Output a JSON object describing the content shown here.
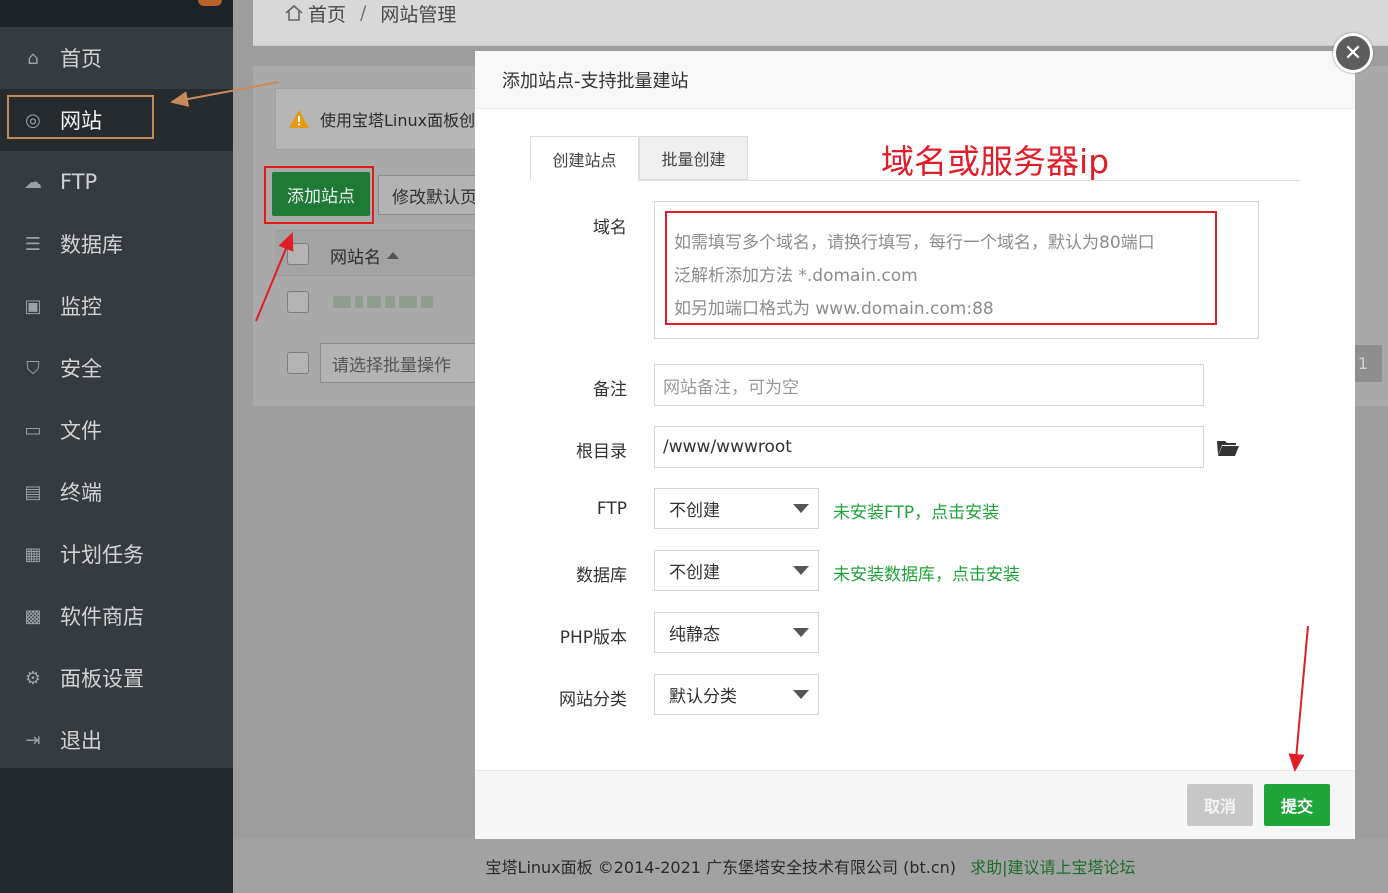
{
  "sidebar": {
    "items": [
      {
        "label": "首页",
        "icon": "home-icon",
        "glyph": "⌂"
      },
      {
        "label": "网站",
        "icon": "globe-icon",
        "glyph": "◎"
      },
      {
        "label": "FTP",
        "icon": "ftp-icon",
        "glyph": "☁"
      },
      {
        "label": "数据库",
        "icon": "database-icon",
        "glyph": "☰"
      },
      {
        "label": "监控",
        "icon": "monitor-icon",
        "glyph": "▣"
      },
      {
        "label": "安全",
        "icon": "shield-icon",
        "glyph": "⛉"
      },
      {
        "label": "文件",
        "icon": "folder-icon",
        "glyph": "▭"
      },
      {
        "label": "终端",
        "icon": "terminal-icon",
        "glyph": "▤"
      },
      {
        "label": "计划任务",
        "icon": "calendar-icon",
        "glyph": "▦"
      },
      {
        "label": "软件商店",
        "icon": "apps-icon",
        "glyph": "▩"
      },
      {
        "label": "面板设置",
        "icon": "gear-icon",
        "glyph": "⚙"
      },
      {
        "label": "退出",
        "icon": "logout-icon",
        "glyph": "⇥"
      }
    ],
    "active_index": 1
  },
  "breadcrumb": {
    "home": "首页",
    "separator": "/",
    "current": "网站管理"
  },
  "alert": {
    "text": "使用宝塔Linux面板创"
  },
  "toolbar": {
    "add_site": "添加站点",
    "modify_default": "修改默认页"
  },
  "table": {
    "col_name": "网站名"
  },
  "batch": {
    "placeholder": "请选择批量操作"
  },
  "pagination": {
    "current": "1"
  },
  "modal": {
    "title": "添加站点-支持批量建站",
    "close_glyph": "✕",
    "tabs": [
      "创建站点",
      "批量创建"
    ],
    "annotation": "域名或服务器ip",
    "domain": {
      "label": "域名",
      "placeholder_lines": [
        "如需填写多个域名，请换行填写，每行一个域名，默认为80端口",
        "泛解析添加方法 *.domain.com",
        "如另加端口格式为 www.domain.com:88"
      ]
    },
    "remark": {
      "label": "备注",
      "placeholder": "网站备注，可为空"
    },
    "root": {
      "label": "根目录",
      "value": "/www/wwwroot"
    },
    "ftp": {
      "label": "FTP",
      "value": "不创建",
      "hint": "未安装FTP，点击安装"
    },
    "database": {
      "label": "数据库",
      "value": "不创建",
      "hint": "未安装数据库，点击安装"
    },
    "php": {
      "label": "PHP版本",
      "value": "纯静态"
    },
    "category": {
      "label": "网站分类",
      "value": "默认分类"
    },
    "cancel": "取消",
    "submit": "提交"
  },
  "footer": {
    "copyright": "宝塔Linux面板 ©2014-2021 广东堡塔安全技术有限公司 (bt.cn)",
    "link": "求助|建议请上宝塔论坛"
  }
}
